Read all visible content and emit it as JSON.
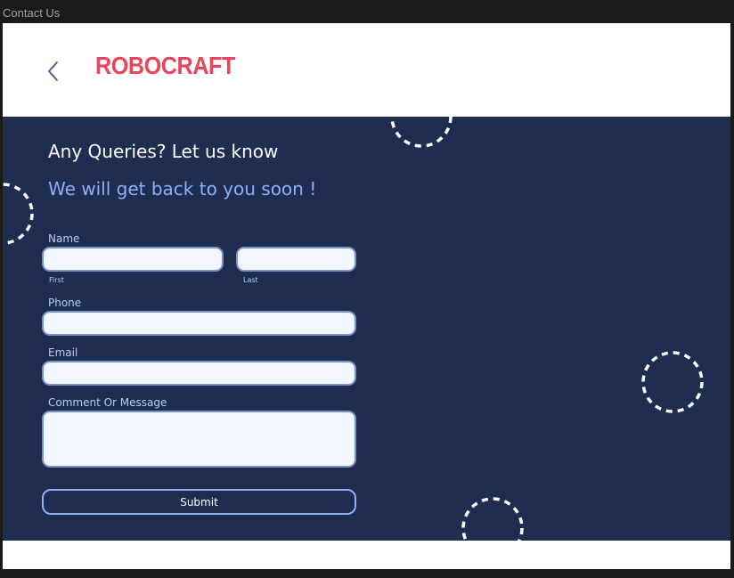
{
  "window": {
    "title": "Contact Us"
  },
  "header": {
    "brand": "ROBOCRAFT",
    "back_icon": "chevron-left-icon"
  },
  "form": {
    "heading": "Any Queries? Let us know",
    "subheading": "We will get back to you soon !",
    "name": {
      "label": "Name",
      "first": {
        "sublabel": "First",
        "value": "",
        "placeholder": ""
      },
      "last": {
        "sublabel": "Last",
        "value": "",
        "placeholder": ""
      }
    },
    "phone": {
      "label": "Phone",
      "value": "",
      "placeholder": ""
    },
    "email": {
      "label": "Email",
      "value": "",
      "placeholder": ""
    },
    "message": {
      "label": "Comment Or Message",
      "value": "",
      "placeholder": ""
    },
    "submit_label": "Submit"
  },
  "colors": {
    "brand": "#e8465d",
    "background": "#1e2d50",
    "subheading": "#8fb0f3",
    "input_fill": "#f3f6ff",
    "input_border": "#7891c9"
  }
}
